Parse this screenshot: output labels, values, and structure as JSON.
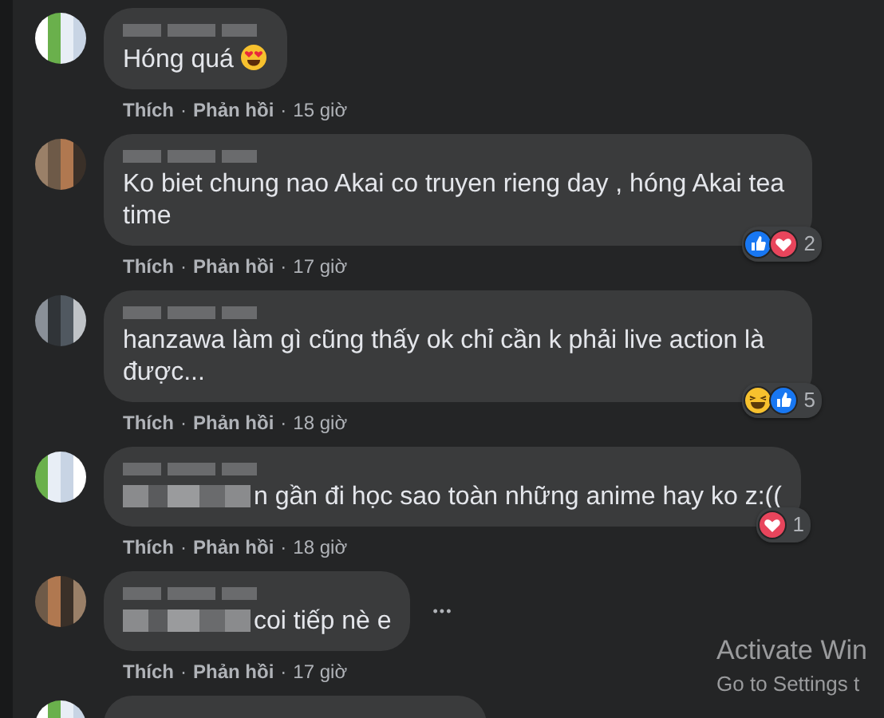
{
  "comments": [
    {
      "text": "Hóng quá",
      "emoji": true,
      "text_blurred_prefix": false,
      "actions": {
        "like": "Thích",
        "sep1": "·",
        "reply": "Phản hồi",
        "sep2": "·",
        "time": "15 giờ"
      }
    },
    {
      "text": "Ko biet chung nao Akai co truyen rieng day , hóng Akai tea time",
      "emoji": false,
      "text_blurred_prefix": false,
      "actions": {
        "like": "Thích",
        "sep1": "·",
        "reply": "Phản hồi",
        "sep2": "·",
        "time": "17 giờ"
      },
      "reactions": [
        {
          "kind": "like"
        },
        {
          "kind": "love"
        }
      ],
      "count": "2"
    },
    {
      "text": "hanzawa làm gì cũng thấy ok chỉ cần k phải live action là được...",
      "emoji": false,
      "text_blurred_prefix": false,
      "actions": {
        "like": "Thích",
        "sep1": "·",
        "reply": "Phản hồi",
        "sep2": "·",
        "time": "18 giờ"
      },
      "reactions": [
        {
          "kind": "haha"
        },
        {
          "kind": "like"
        }
      ],
      "count": "5"
    },
    {
      "text": "n gần đi học sao toàn những anime hay ko z:((",
      "emoji": false,
      "text_blurred_prefix": true,
      "actions": {
        "like": "Thích",
        "sep1": "·",
        "reply": "Phản hồi",
        "sep2": "·",
        "time": "18 giờ"
      },
      "reactions": [
        {
          "kind": "love"
        }
      ],
      "count": "1"
    },
    {
      "text": "coi tiếp nè e",
      "emoji": false,
      "text_blurred_prefix": true,
      "actions": {
        "like": "Thích",
        "sep1": "·",
        "reply": "Phản hồi",
        "sep2": "·",
        "time": "17 giờ"
      },
      "more": "•••"
    }
  ],
  "os_overlay": {
    "title": "Activate Win",
    "subtitle": "Go to Settings t"
  }
}
